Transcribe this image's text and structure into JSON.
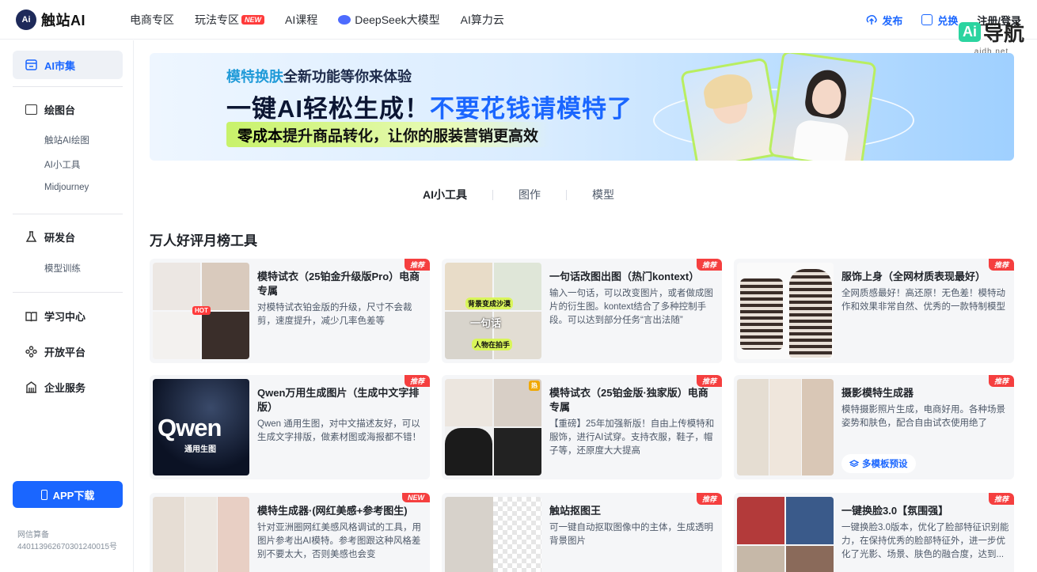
{
  "brand": {
    "logo_text": "Ai",
    "name": "触站AI"
  },
  "topnav": [
    {
      "label": "电商专区",
      "badge": ""
    },
    {
      "label": "玩法专区",
      "badge": "NEW"
    },
    {
      "label": "AI课程",
      "badge": ""
    },
    {
      "label": "DeepSeek大模型",
      "badge": ""
    },
    {
      "label": "AI算力云",
      "badge": ""
    }
  ],
  "top_right": {
    "publish": "发布",
    "exchange": "兑换",
    "login": "注册/登录"
  },
  "watermark": {
    "ai": "Ai",
    "text": "导航",
    "url": "aidh.net"
  },
  "sidebar": {
    "active": "AI市集",
    "sections": [
      {
        "label": "绘图台",
        "items": [
          "触站AI绘图",
          "AI小工具",
          "Midjourney"
        ]
      },
      {
        "label": "研发台",
        "items": [
          "模型训练"
        ]
      },
      {
        "label": "学习中心",
        "items": []
      },
      {
        "label": "开放平台",
        "items": []
      },
      {
        "label": "企业服务",
        "items": []
      }
    ],
    "app_button": "APP下载",
    "icp_label": "网信算备",
    "icp_number": "440113962670301240015号"
  },
  "banner": {
    "line1_highlight": "模特换肤",
    "line1_rest": "全新功能等你来体验",
    "line2_a": "一键AI轻松生成！",
    "line2_b": "不要花钱请模特了",
    "line3_bold": "零成本",
    "line3_rest": "提升商品转化，让你的服装营销更高效"
  },
  "tabs": [
    "AI小工具",
    "图作",
    "模型"
  ],
  "section_title": "万人好评月榜工具",
  "cards": [
    {
      "title": "模特试衣（25铂金升级版Pro）电商专属",
      "desc": "对模特试衣铂金版的升级，尺寸不会裁剪，速度提升，减少几率色差等",
      "tag": "推荐"
    },
    {
      "title": "一句话改图出图（热门kontext）",
      "desc": "输入一句话，可以改变图片，或者做成图片的衍生图。kontext结合了多种控制手段。可以达到部分任务“言出法随”",
      "tag": "推荐"
    },
    {
      "title": "服饰上身（全网材质表现最好）",
      "desc": "全网质感最好！高还原！无色差！模特动作和效果非常自然、优秀的一款特制模型",
      "tag": "推荐"
    },
    {
      "title": "Qwen万用生成图片（生成中文字排版）",
      "desc": "Qwen 通用生图，对中文描述友好，可以生成文字排版，做素材图或海报都不错！",
      "tag": "推荐"
    },
    {
      "title": "模特试衣（25铂金版·独家版）电商专属",
      "desc": "【重磅】25年加强新版！自由上传模特和服饰，进行AI试穿。支持衣服，鞋子，帽子等，还原度大大提高",
      "tag": "推荐"
    },
    {
      "title": "摄影模特生成器",
      "desc": "模特摄影照片生成，电商好用。各种场景姿势和肤色，配合自由试衣使用绝了",
      "tag": "推荐",
      "extra_button": "多模板预设"
    },
    {
      "title": "模特生成器·(网红美感+参考图生)",
      "desc": "针对亚洲圈网红美感风格调试的工具，用图片参考出AI模特。参考图跟这种风格差别不要太大，否则美感也会变",
      "tag": "NEW"
    },
    {
      "title": "触站抠图王",
      "desc": "可一键自动抠取图像中的主体，生成透明背景图片",
      "tag": "推荐"
    },
    {
      "title": "一键换脸3.0【氛围强】",
      "desc": "一键换脸3.0版本，优化了脸部特征识别能力，在保持优秀的脸部特征外，进一步优化了光影、场景、肤色的融合度，达到...",
      "tag": "推荐"
    }
  ],
  "thumb_labels": {
    "hot": "HOT",
    "hot2": "热",
    "speech1": "背景变成沙漠",
    "speech2": "一句话",
    "speech3": "人物在拍手",
    "qwen_big": "Qwen",
    "qwen_small": "通用生图"
  },
  "colors": {
    "accent": "#1a66ff",
    "tag_red": "#f53f3f",
    "lime": "#c8f26a"
  }
}
